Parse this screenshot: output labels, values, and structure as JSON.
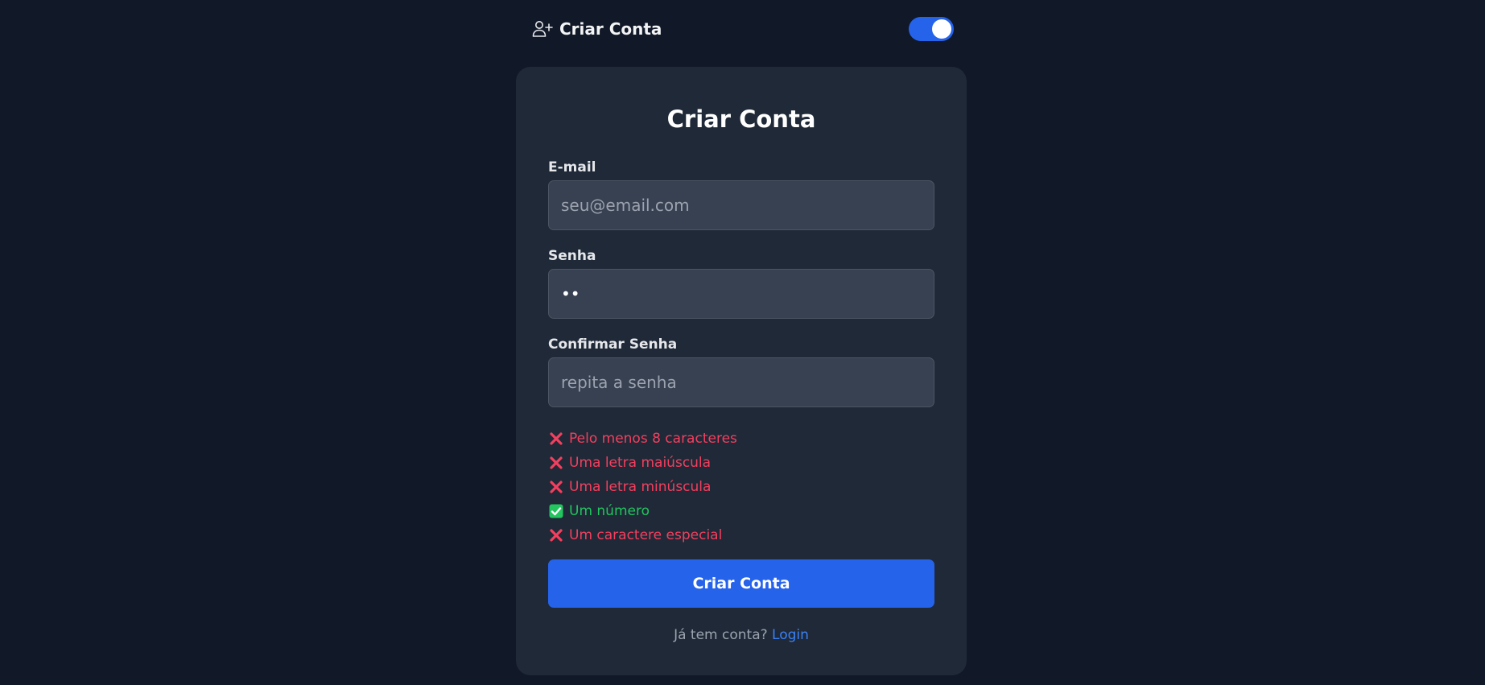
{
  "header": {
    "brand_label": "Criar Conta",
    "brand_icon": "user-plus-icon",
    "theme_toggle_on": true,
    "accent_color": "#2563eb"
  },
  "form": {
    "title": "Criar Conta",
    "email": {
      "label": "E-mail",
      "placeholder": "seu@email.com",
      "value": ""
    },
    "password": {
      "label": "Senha",
      "placeholder": "",
      "value": "••"
    },
    "confirm": {
      "label": "Confirmar Senha",
      "placeholder": "repita a senha",
      "value": ""
    },
    "rules": [
      {
        "text": "Pelo menos 8 caracteres",
        "status": "fail",
        "icon": "x-icon"
      },
      {
        "text": "Uma letra maiúscula",
        "status": "fail",
        "icon": "x-icon"
      },
      {
        "text": "Uma letra minúscula",
        "status": "fail",
        "icon": "x-icon"
      },
      {
        "text": "Um número",
        "status": "ok",
        "icon": "check-icon"
      },
      {
        "text": "Um caractere especial",
        "status": "fail",
        "icon": "x-icon"
      }
    ],
    "submit_label": "Criar Conta",
    "footer_text": "Já tem conta?",
    "login_label": "Login"
  },
  "colors": {
    "background": "#111827",
    "card": "#1f2937",
    "input": "#374151",
    "fail": "#f43f5e",
    "ok": "#22c55e",
    "link": "#3b82f6"
  }
}
